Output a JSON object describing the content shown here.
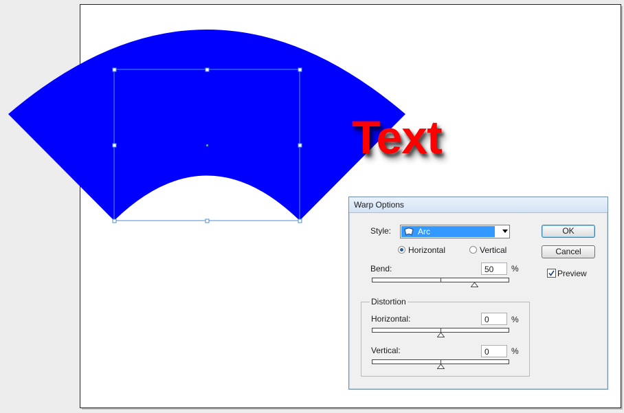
{
  "canvas": {
    "warp_color": "#0000ff",
    "text_color": "#ff0000",
    "warped_text": "Text"
  },
  "dialog": {
    "title": "Warp Options",
    "style_label": "Style:",
    "style_value": "Arc",
    "style_icon": "arc-flag-icon",
    "orientation": {
      "horizontal_label": "Horizontal",
      "vertical_label": "Vertical",
      "selected": "Horizontal"
    },
    "bend_label": "Bend:",
    "bend_value": "50",
    "bend_unit": "%",
    "bend_level": 50,
    "distortion_label": "Distortion",
    "horizontal_label": "Horizontal:",
    "horizontal_value": "0",
    "horizontal_unit": "%",
    "horizontal_level": 0,
    "vertical_label": "Vertical:",
    "vertical_value": "0",
    "vertical_unit": "%",
    "vertical_level": 0,
    "ok_label": "OK",
    "cancel_label": "Cancel",
    "preview_label": "Preview",
    "preview_checked": true
  }
}
